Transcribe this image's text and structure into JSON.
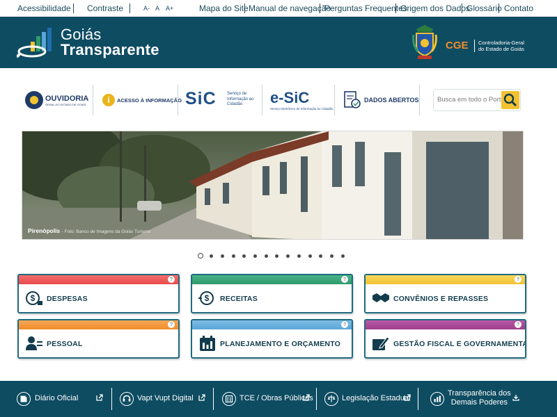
{
  "topbar": {
    "accessibility": "Acessibilidade",
    "contrast": "Contraste",
    "font_decrease": "A-",
    "font_normal": "A",
    "font_increase": "A+",
    "links": [
      "Mapa do Site",
      "Manual de navegação",
      "Perguntas Frequentes",
      "Origem dos Dados",
      "Glossário",
      "Contato"
    ]
  },
  "header": {
    "logo_line1": "Goiás",
    "logo_line2": "Transparente",
    "cge_abbr": "CGE",
    "cge_name_line1": "Controladoria-Geral",
    "cge_name_line2": "do Estado de Goiás"
  },
  "services": {
    "ouvidoria_title": "OUVIDORIA",
    "ouvidoria_sub": "GERAL DO ESTADO DE GOIÁS",
    "acesso_info": "ACESSO À INFORMAÇÃO",
    "sic_title": "SiC",
    "sic_sub_line1": "Serviço de",
    "sic_sub_line2": "Informação ao",
    "sic_sub_line3": "Cidadão",
    "esic_title": "e-SiC",
    "esic_sub": "Serviço Eletrônico de Informação ao Cidadão",
    "dados_abertos": "DADOS ABERTOS"
  },
  "search": {
    "placeholder": "Busca em todo o Portal"
  },
  "banner": {
    "caption_place": "Pirenópolis",
    "caption_credit": "- Foto: Banco de Imagens da Goiás Turismo"
  },
  "carousel": {
    "total": 14,
    "active_index": 0
  },
  "categories": [
    {
      "label": "DESPESAS",
      "color": "#e94a4a",
      "icon": "money-dollar-icon"
    },
    {
      "label": "RECEITAS",
      "color": "#2e9a6c",
      "icon": "money-in-icon"
    },
    {
      "label": "CONVÊNIOS E REPASSES",
      "color": "#f2c230",
      "icon": "handshake-icon"
    },
    {
      "label": "PESSOAL",
      "color": "#f28c28",
      "icon": "people-icon"
    },
    {
      "label": "PLANEJAMENTO E ORÇAMENTO",
      "color": "#5aa5d8",
      "icon": "calendar-icon"
    },
    {
      "label": "GESTÃO FISCAL E GOVERNAMENTAL",
      "color": "#a03c8c",
      "icon": "signature-icon"
    }
  ],
  "footer": {
    "items": [
      {
        "label": "Diário Oficial",
        "icon": "newspaper-icon"
      },
      {
        "label": "Vapt Vupt Digital",
        "icon": "headset-icon"
      },
      {
        "label": "TCE / Obras Públicas",
        "icon": "building-icon"
      },
      {
        "label": "Legislação Estadual",
        "icon": "scales-icon"
      }
    ],
    "last_line1": "Transparência dos",
    "last_line2": "Demais Poderes",
    "last_icon": "chart-icon"
  },
  "colors": {
    "header_bg": "#0e4c62",
    "accent_yellow": "#f2c230",
    "cge_orange": "#f28c28"
  }
}
